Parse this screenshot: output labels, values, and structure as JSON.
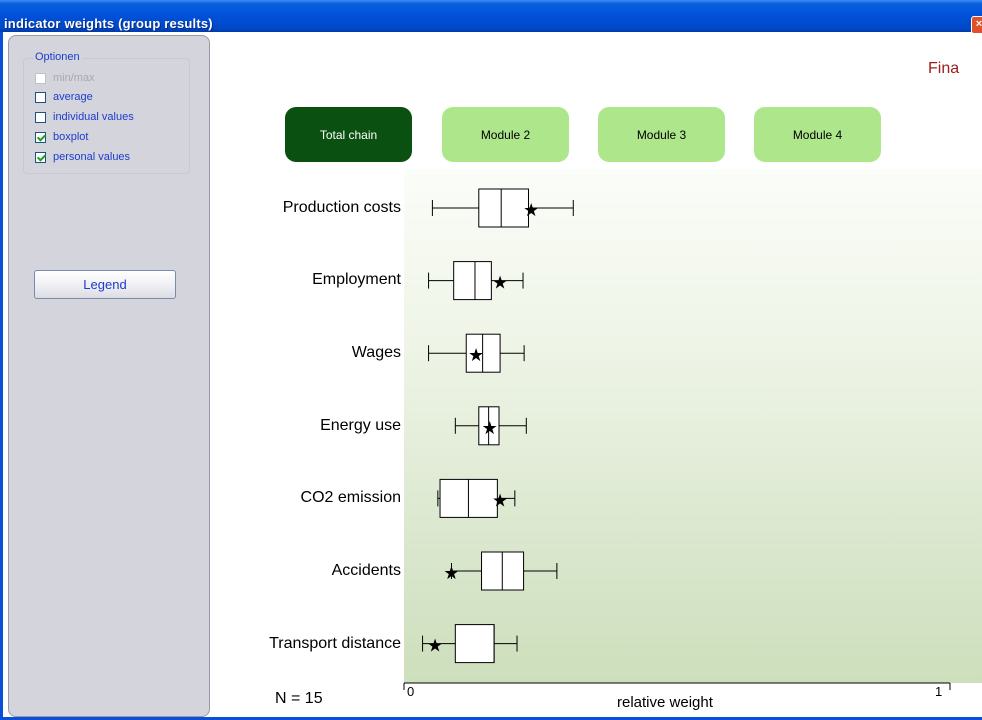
{
  "window": {
    "title": "indicator weights (group results)",
    "close_glyph": "×"
  },
  "sidebar": {
    "options_title": "Optionen",
    "options": [
      {
        "label": "min/max",
        "checked": false,
        "disabled": true
      },
      {
        "label": "average",
        "checked": false,
        "disabled": false
      },
      {
        "label": "individual values",
        "checked": false,
        "disabled": false
      },
      {
        "label": "boxplot",
        "checked": true,
        "disabled": false
      },
      {
        "label": "personal values",
        "checked": true,
        "disabled": false
      }
    ],
    "legend_button": "Legend"
  },
  "header": {
    "final_text": "Fina"
  },
  "tabs": [
    {
      "label": "Total chain",
      "active": true
    },
    {
      "label": "Module 2",
      "active": false
    },
    {
      "label": "Module 3",
      "active": false
    },
    {
      "label": "Module 4",
      "active": false
    }
  ],
  "chart_data": {
    "type": "boxplot",
    "xlabel": "relative weight",
    "xlim": [
      0,
      1
    ],
    "x_ticks": [
      "0",
      "1"
    ],
    "n_label": "N = 15",
    "personal_marker": "★",
    "categories": [
      "Production costs",
      "Employment",
      "Wages",
      "Energy use",
      "CO2 emission",
      "Accidents",
      "Transport distance"
    ],
    "boxes": [
      {
        "min": 0.052,
        "q1": 0.137,
        "median": 0.178,
        "q3": 0.228,
        "max": 0.31,
        "personal": 0.233
      },
      {
        "min": 0.045,
        "q1": 0.091,
        "median": 0.13,
        "q3": 0.16,
        "max": 0.218,
        "personal": 0.176
      },
      {
        "min": 0.045,
        "q1": 0.114,
        "median": 0.144,
        "q3": 0.176,
        "max": 0.22,
        "personal": 0.132
      },
      {
        "min": 0.094,
        "q1": 0.137,
        "median": 0.155,
        "q3": 0.174,
        "max": 0.224,
        "personal": 0.157
      },
      {
        "min": 0.062,
        "q1": 0.066,
        "median": 0.118,
        "q3": 0.171,
        "max": 0.203,
        "personal": 0.176
      },
      {
        "min": 0.087,
        "q1": 0.142,
        "median": 0.18,
        "q3": 0.219,
        "max": 0.28,
        "personal": 0.087
      },
      {
        "min": 0.034,
        "q1": 0.094,
        "median": 0.165,
        "q3": 0.165,
        "max": 0.207,
        "personal": 0.057
      }
    ],
    "colors": {
      "box_stroke": "#000000",
      "box_fill": "#ffffff"
    }
  }
}
